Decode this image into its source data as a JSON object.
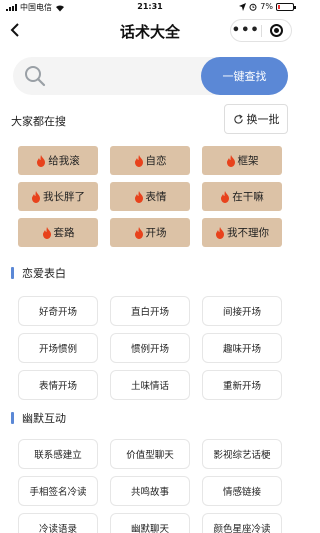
{
  "status_bar": {
    "carrier": "中国电信",
    "time": "21:31",
    "battery": "7%"
  },
  "nav": {
    "title": "话术大全",
    "more": "•••"
  },
  "search": {
    "placeholder": "",
    "button_label": "一键查找"
  },
  "hot": {
    "title": "大家都在搜",
    "refresh_label": "换一批",
    "tags": [
      "给我滚",
      "自恋",
      "框架",
      "我长胖了",
      "表情",
      "在干嘛",
      "套路",
      "开场",
      "我不理你"
    ]
  },
  "sections": [
    {
      "title": "恋爱表白",
      "items": [
        "好奇开场",
        "直白开场",
        "间接开场",
        "开场惯例",
        "惯例开场",
        "趣味开场",
        "表情开场",
        "土味情话",
        "重新开场"
      ]
    },
    {
      "title": "幽默互动",
      "items": [
        "联系感建立",
        "价值型聊天",
        "影视综艺话梗",
        "手相签名冷读",
        "共鸣故事",
        "情感链接",
        "冷读语录",
        "幽默聊天",
        "颜色星座冷读"
      ]
    }
  ],
  "colors": {
    "accent": "#5b88d6",
    "hot_tag_bg": "#dcc2a6",
    "flame": "#e8421c"
  }
}
